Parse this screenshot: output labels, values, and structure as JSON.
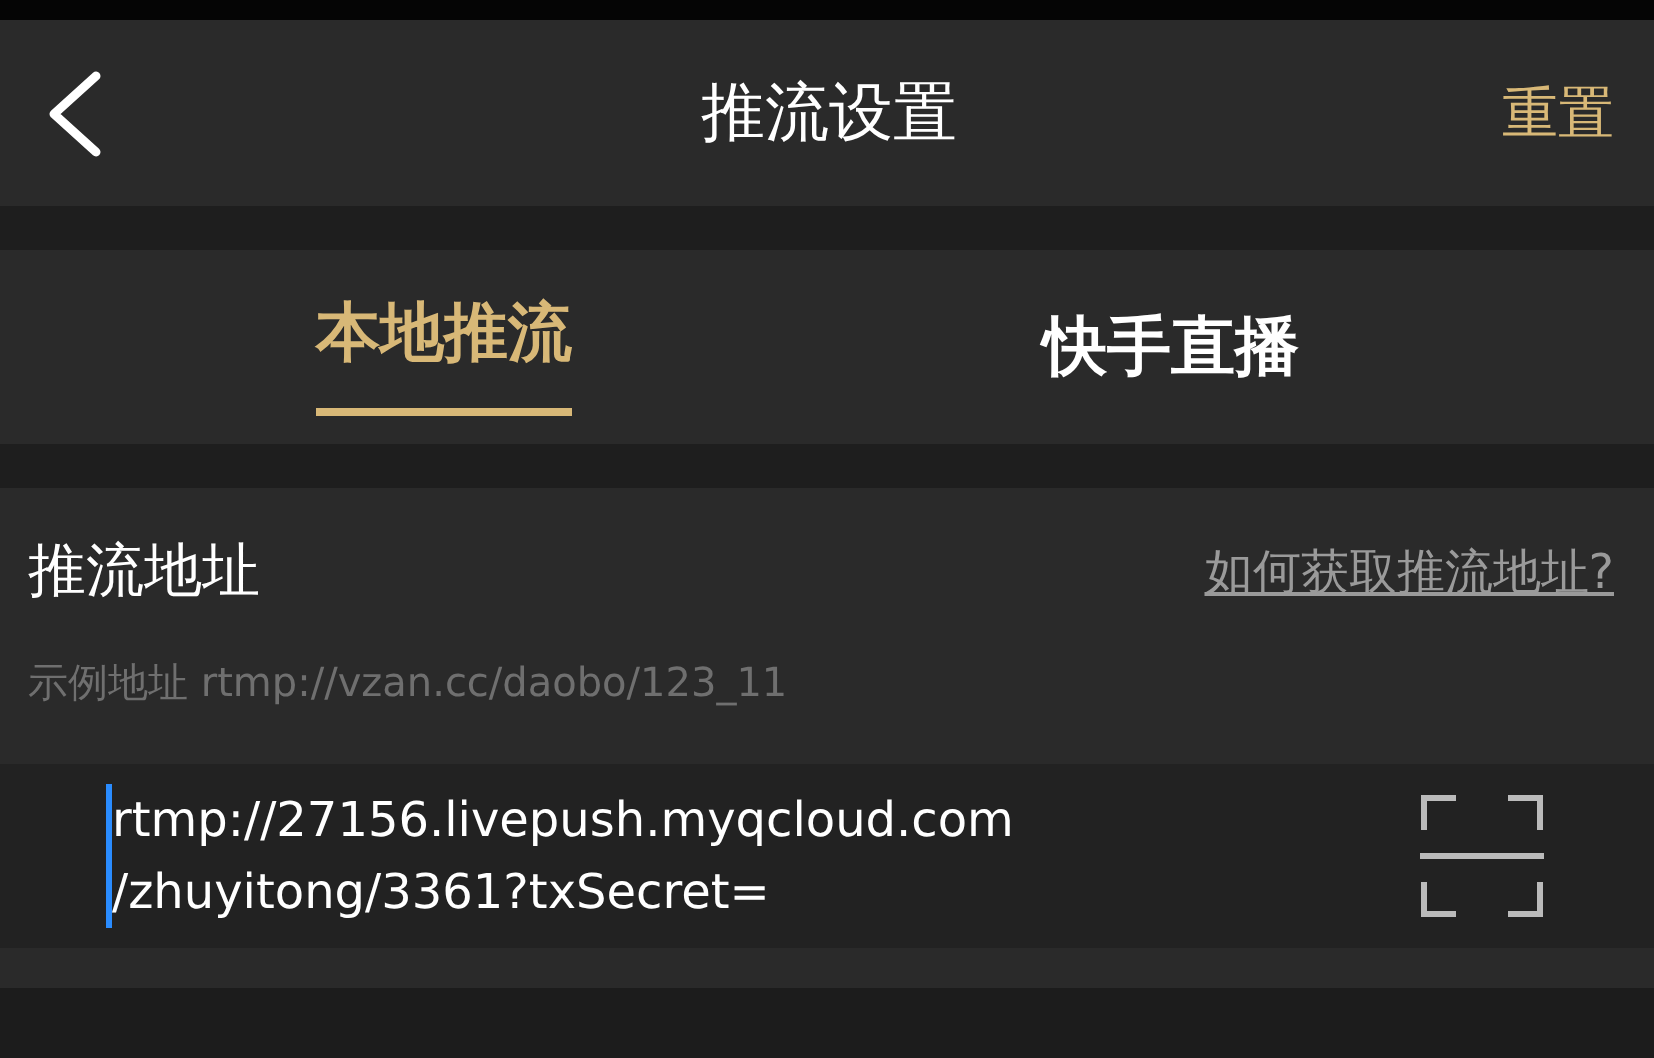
{
  "header": {
    "title": "推流设置",
    "action": "重置"
  },
  "tabs": [
    {
      "label": "本地推流",
      "selected": true
    },
    {
      "label": "快手直播",
      "selected": false
    }
  ],
  "push_address": {
    "label": "推流地址",
    "help_link": "如何获取推流地址?",
    "example": "示例地址 rtmp://vzan.cc/daobo/123_11",
    "value_lines": [
      "rtmp://27156.livepush.myqcloud.com",
      "/zhuyitong/3361?txSecret="
    ],
    "focused": true
  }
}
